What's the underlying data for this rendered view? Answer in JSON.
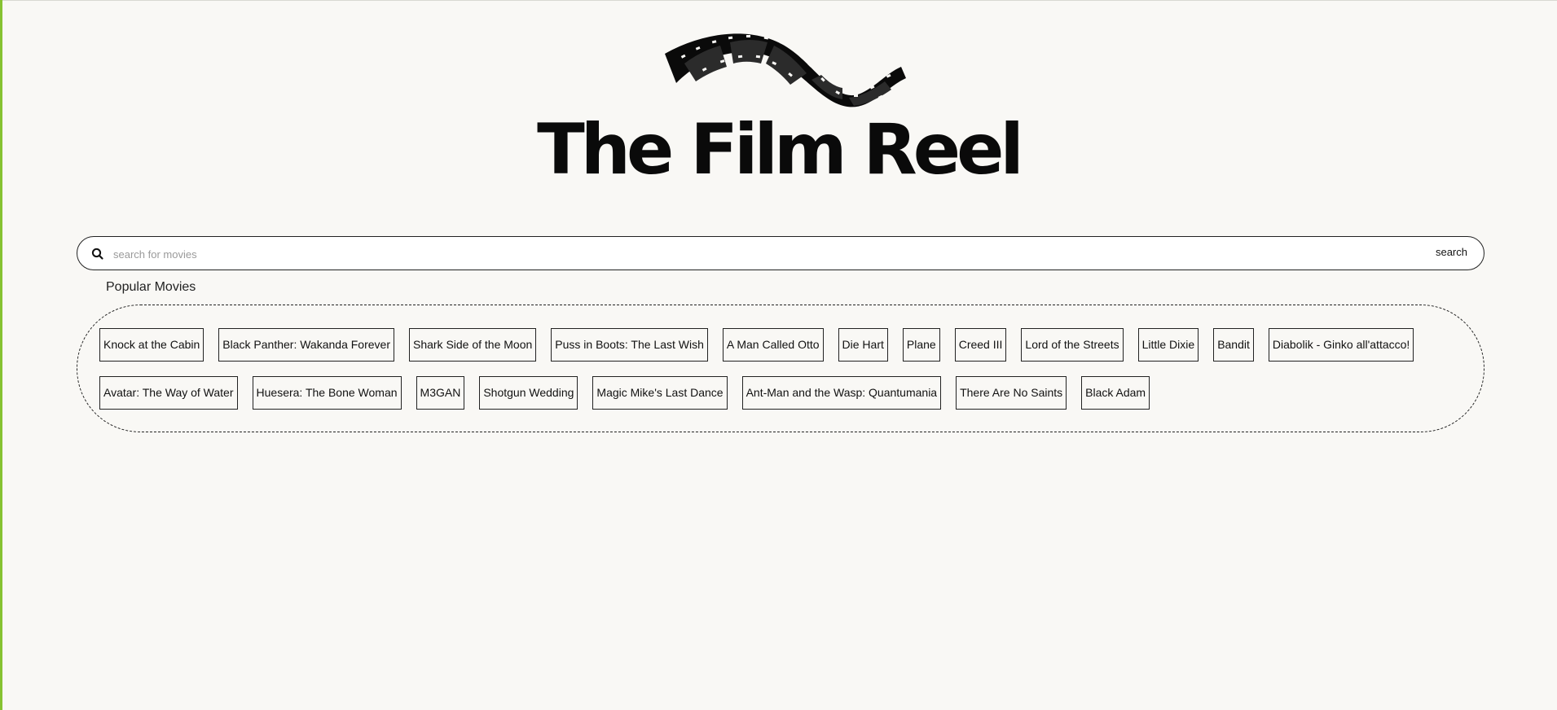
{
  "site": {
    "title": "The Film Reel",
    "accent_color": "#86c232",
    "logo_icon": "film-strip-icon"
  },
  "search": {
    "icon": "search-icon",
    "placeholder": "search for movies",
    "value": "",
    "button_label": "search"
  },
  "popular": {
    "heading": "Popular Movies",
    "movies": [
      "Knock at the Cabin",
      "Black Panther: Wakanda Forever",
      "Shark Side of the Moon",
      "Puss in Boots: The Last Wish",
      "A Man Called Otto",
      "Die Hart",
      "Plane",
      "Creed III",
      "Lord of the Streets",
      "Little Dixie",
      "Bandit",
      "Diabolik - Ginko all'attacco!",
      "Avatar: The Way of Water",
      "Huesera: The Bone Woman",
      "M3GAN",
      "Shotgun Wedding",
      "Magic Mike's Last Dance",
      "Ant-Man and the Wasp: Quantumania",
      "There Are No Saints",
      "Black Adam"
    ]
  }
}
